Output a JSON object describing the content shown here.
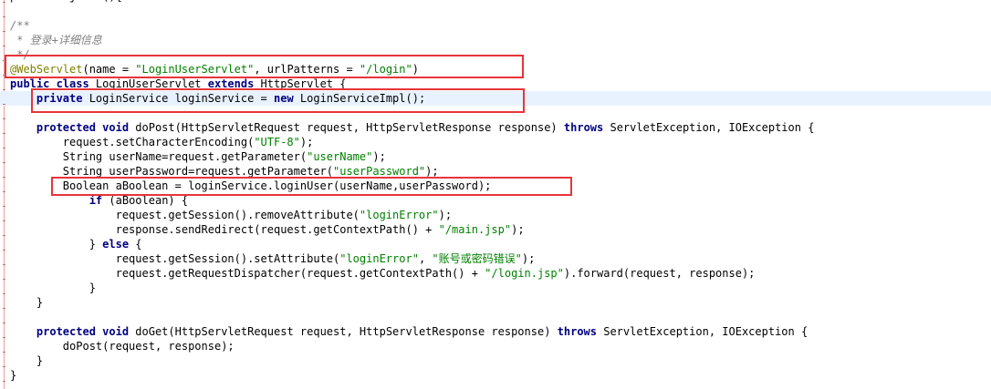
{
  "colors": {
    "keyword": "#000080",
    "string": "#008000",
    "comment": "#808080",
    "annotation": "#808000",
    "highlight": "#e8f2fe",
    "box": "#e8343a"
  },
  "lines": [
    [
      {
        "t": "public Object "
      },
      {
        "t": "()"
      },
      {
        "t": "{"
      }
    ],
    [],
    [
      {
        "c": "cmt",
        "t": "/**"
      }
    ],
    [
      {
        "c": "cmt",
        "t": " * 登录+详细信息"
      }
    ],
    [
      {
        "c": "cmt",
        "t": " */"
      }
    ],
    [
      {
        "c": "ann",
        "t": "@WebServlet"
      },
      {
        "t": "(name = "
      },
      {
        "c": "str",
        "t": "\"LoginUserServlet\""
      },
      {
        "t": ", urlPatterns = "
      },
      {
        "c": "str",
        "t": "\"/login\""
      },
      {
        "t": ")"
      }
    ],
    [
      {
        "c": "kw",
        "t": "public class "
      },
      {
        "t": "LoginUserServlet "
      },
      {
        "c": "kw",
        "t": "extends "
      },
      {
        "t": "HttpServlet {"
      }
    ],
    [
      {
        "t": "    "
      },
      {
        "c": "kw",
        "t": "private "
      },
      {
        "t": "LoginService loginService = "
      },
      {
        "c": "kw",
        "t": "new "
      },
      {
        "t": "LoginServiceImpl();"
      }
    ],
    [],
    [
      {
        "t": "    "
      },
      {
        "c": "kw",
        "t": "protected void "
      },
      {
        "t": "doPost(HttpServletRequest request, HttpServletResponse response) "
      },
      {
        "c": "kw",
        "t": "throws "
      },
      {
        "t": "ServletException, IOException {"
      }
    ],
    [
      {
        "t": "        request.setCharacterEncoding("
      },
      {
        "c": "str",
        "t": "\"UTF-8\""
      },
      {
        "t": ");"
      }
    ],
    [
      {
        "t": "        String userName=request.getParameter("
      },
      {
        "c": "str",
        "t": "\"userName\""
      },
      {
        "t": ");"
      }
    ],
    [
      {
        "t": "        String userPassword=request.getParameter("
      },
      {
        "c": "str",
        "t": "\"userPassword\""
      },
      {
        "t": ");"
      }
    ],
    [
      {
        "t": "        Boolean aBoolean = loginService.loginUser(userName,userPassword);"
      }
    ],
    [
      {
        "t": "            "
      },
      {
        "c": "kw",
        "t": "if "
      },
      {
        "t": "(aBoolean) {"
      }
    ],
    [
      {
        "t": "                request.getSession().removeAttribute("
      },
      {
        "c": "str",
        "t": "\"loginError\""
      },
      {
        "t": ");"
      }
    ],
    [
      {
        "t": "                response.sendRedirect(request.getContextPath() + "
      },
      {
        "c": "str",
        "t": "\"/main.jsp\""
      },
      {
        "t": ");"
      }
    ],
    [
      {
        "t": "            } "
      },
      {
        "c": "kw",
        "t": "else "
      },
      {
        "t": "{"
      }
    ],
    [
      {
        "t": "                request.getSession().setAttribute("
      },
      {
        "c": "str",
        "t": "\"loginError\""
      },
      {
        "t": ", "
      },
      {
        "c": "str",
        "t": "\"账号或密码错误\""
      },
      {
        "t": ");"
      }
    ],
    [
      {
        "t": "                request.getRequestDispatcher(request.getContextPath() + "
      },
      {
        "c": "str",
        "t": "\"/login.jsp\""
      },
      {
        "t": ").forward(request, response);"
      }
    ],
    [
      {
        "t": "            }"
      }
    ],
    [
      {
        "t": "    }"
      }
    ],
    [],
    [
      {
        "t": "    "
      },
      {
        "c": "kw",
        "t": "protected void "
      },
      {
        "t": "doGet(HttpServletRequest request, HttpServletResponse response) "
      },
      {
        "c": "kw",
        "t": "throws "
      },
      {
        "t": "ServletException, IOException {"
      }
    ],
    [
      {
        "t": "        doPost(request, response);"
      }
    ],
    [
      {
        "t": "    }"
      }
    ],
    [
      {
        "t": "}"
      }
    ]
  ]
}
